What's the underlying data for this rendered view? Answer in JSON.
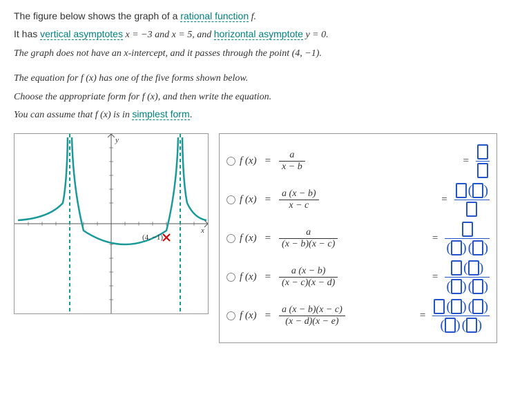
{
  "intro": {
    "line1a": "The figure below shows the graph of a ",
    "link_rational": "rational function",
    "line1b": " f.",
    "line2a": "It has ",
    "link_vertical": "vertical asymptotes",
    "line2b": " x = −3 and x = 5, and ",
    "link_horizontal": "horizontal asymptote",
    "line2c": " y = 0.",
    "line3": "The graph does not have an x-intercept, and it passes through the point (4, −1).",
    "line4": "The equation for f (x) has one of the five forms shown below.",
    "line5": "Choose the appropriate form for f (x), and then write the equation.",
    "line6a": "You can assume that f (x) is in ",
    "link_simplest": "simplest form",
    "line6b": "."
  },
  "graph": {
    "point_label": "(4, −1)",
    "x_label": "x",
    "y_label": "y",
    "vertical_asymptotes": [
      -3,
      5
    ],
    "horizontal_asymptote": 0,
    "x_range": [
      -8,
      8
    ],
    "y_range": [
      -8,
      8
    ]
  },
  "forms": {
    "fx": "f (x)",
    "equals": "=",
    "opt1": {
      "num": "a",
      "den": "x − b"
    },
    "opt2": {
      "num": "a (x − b)",
      "den": "x − c"
    },
    "opt3": {
      "num": "a",
      "den": "(x − b)(x − c)"
    },
    "opt4": {
      "num": "a (x − b)",
      "den": "(x − c)(x − d)"
    },
    "opt5": {
      "num": "a (x − b)(x − c)",
      "den": "(x − d)(x − e)"
    }
  }
}
